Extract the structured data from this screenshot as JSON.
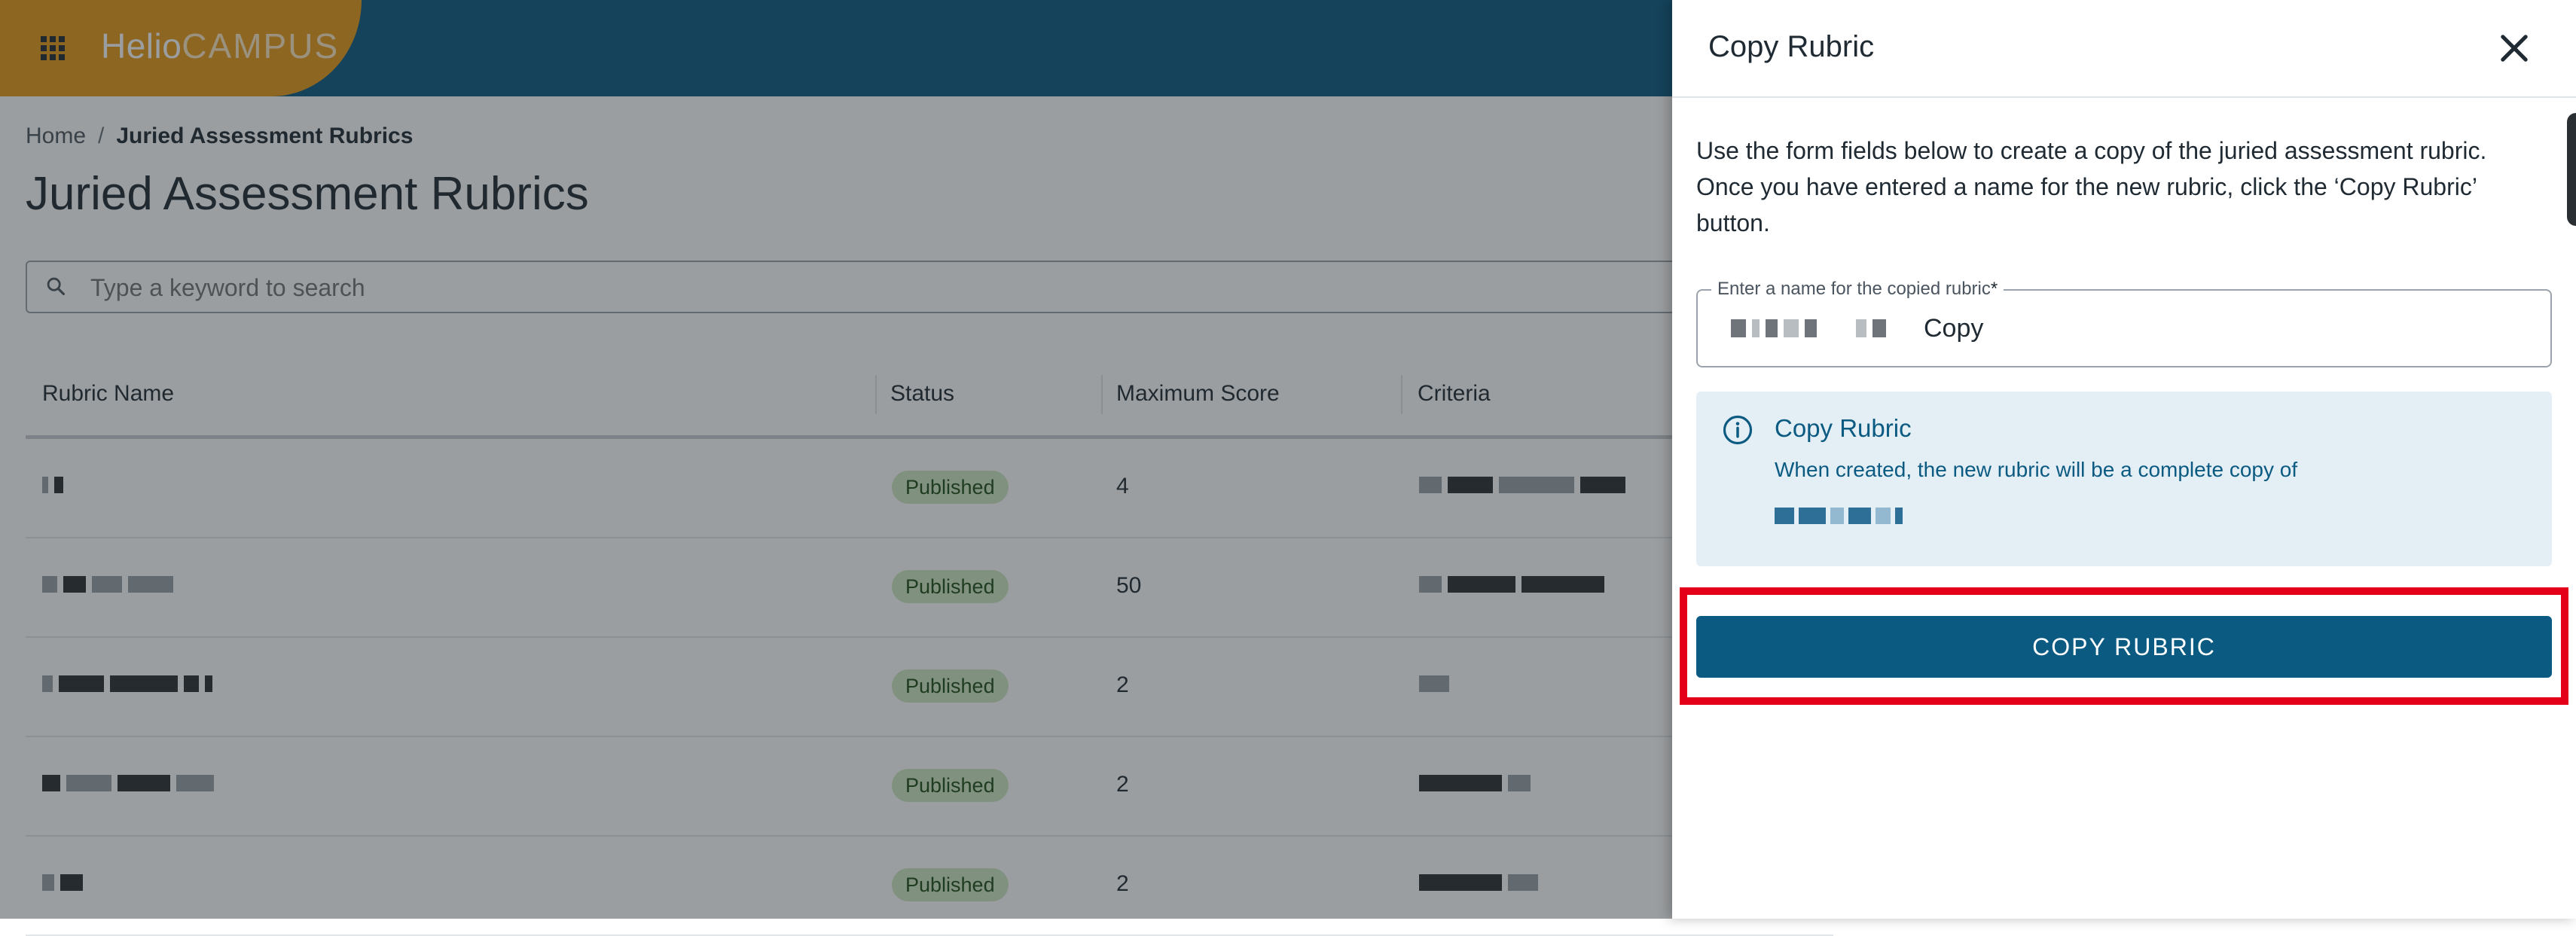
{
  "app": {
    "logo_primary": "Helio",
    "logo_secondary": "CAMPUS"
  },
  "breadcrumb": {
    "home": "Home",
    "separator": "/",
    "current": "Juried Assessment Rubrics"
  },
  "page": {
    "title": "Juried Assessment Rubrics"
  },
  "search": {
    "placeholder": "Type a keyword to search"
  },
  "table": {
    "headers": {
      "name": "Rubric Name",
      "status": "Status",
      "max_score": "Maximum Score",
      "criteria": "Criteria"
    },
    "rows": [
      {
        "status": "Published",
        "max_score": "4"
      },
      {
        "status": "Published",
        "max_score": "50"
      },
      {
        "status": "Published",
        "max_score": "2"
      },
      {
        "status": "Published",
        "max_score": "2"
      },
      {
        "status": "Published",
        "max_score": "2"
      }
    ]
  },
  "drawer": {
    "title": "Copy Rubric",
    "intro": "Use the form fields below to create a copy of the juried assessment rubric. Once you have entered a name for the new rubric, click the ‘Copy Rubric’ button.",
    "field": {
      "label": "Enter a name for the copied rubric",
      "required_mark": "*",
      "value": "Copy"
    },
    "info": {
      "title": "Copy Rubric",
      "text": "When created, the new rubric will be a complete copy of"
    },
    "copy_button": "COPY RUBRIC"
  },
  "colors": {
    "brand_blue": "#0b5a82",
    "brand_orange": "#e59a1a",
    "published_badge_bg": "#cfe7c4",
    "highlight_red": "#e5001a"
  }
}
